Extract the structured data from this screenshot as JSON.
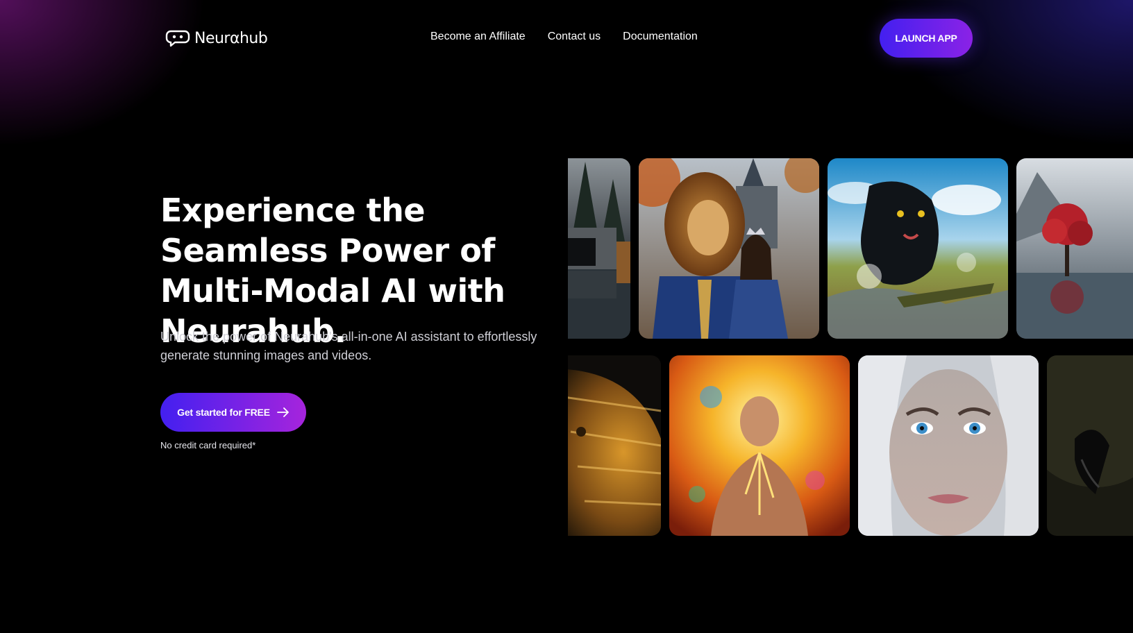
{
  "brand": {
    "name": "Neurαhub"
  },
  "nav": {
    "items": [
      {
        "label": "Become an Affiliate"
      },
      {
        "label": "Contact us"
      },
      {
        "label": "Documentation"
      }
    ],
    "launch_label": "LAUNCH APP"
  },
  "hero": {
    "title": "Experience the Seamless Power of Multi-Modal AI with Neurahub.",
    "subtitle": "Unlock the power of Neurahub's all-in-one AI assistant to effortlessly generate stunning images and videos.",
    "cta_label": "Get started for FREE",
    "cta_note": "No credit card required*"
  },
  "gallery": {
    "tiles": [
      {
        "subject": "modern-house-lake"
      },
      {
        "subject": "lion-king-and-queen"
      },
      {
        "subject": "black-panther-water"
      },
      {
        "subject": "red-tree-lake"
      },
      {
        "subject": "golden-eagle"
      },
      {
        "subject": "fiery-man"
      },
      {
        "subject": "white-haired-woman"
      },
      {
        "subject": "dark-bird"
      }
    ]
  },
  "colors": {
    "accent_start": "#4320f0",
    "accent_end": "#a624dc",
    "background": "#000000"
  },
  "icons": {
    "logo": "chat-bubble-icon",
    "cta": "arrow-right-icon"
  }
}
